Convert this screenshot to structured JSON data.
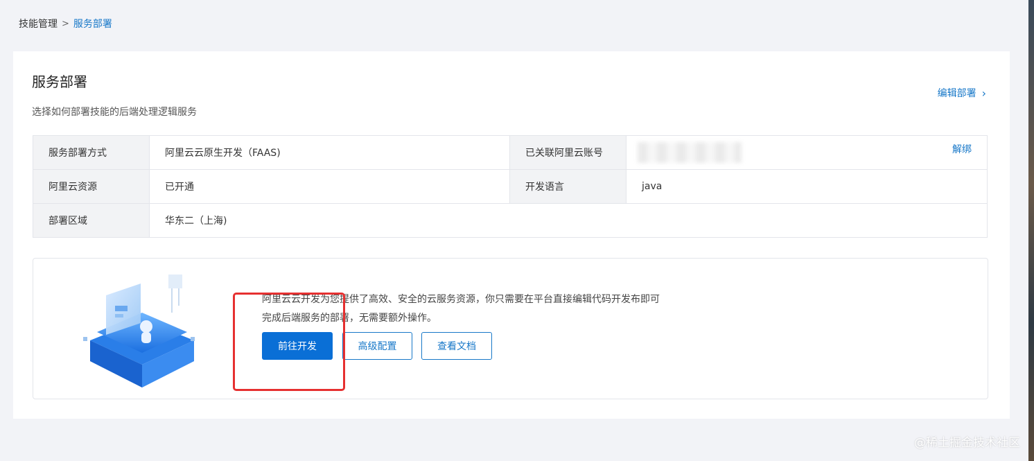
{
  "breadcrumb": {
    "parent": "技能管理",
    "current": "服务部署"
  },
  "card": {
    "title": "服务部署",
    "description": "选择如何部署技能的后端处理逻辑服务",
    "edit_label": "编辑部署"
  },
  "info": {
    "deploy_method_label": "服务部署方式",
    "deploy_method_value": "阿里云云原生开发（FAAS)",
    "account_label": "已关联阿里云账号",
    "unbind_label": "解绑",
    "resource_label": "阿里云资源",
    "resource_value": "已开通",
    "language_label": "开发语言",
    "language_value": "java",
    "region_label": "部署区域",
    "region_value": "华东二（上海)"
  },
  "promo": {
    "text": "阿里云云开发为您提供了高效、安全的云服务资源，你只需要在平台直接编辑代码开发布即可完成后端服务的部署，无需要额外操作。",
    "primary_button": "前往开发",
    "advanced_button": "高级配置",
    "docs_button": "查看文档"
  },
  "watermark": "@稀土掘金技术社区",
  "colors": {
    "accent": "#1677c8",
    "primary_button": "#0a6fd6",
    "highlight": "#e63030"
  }
}
